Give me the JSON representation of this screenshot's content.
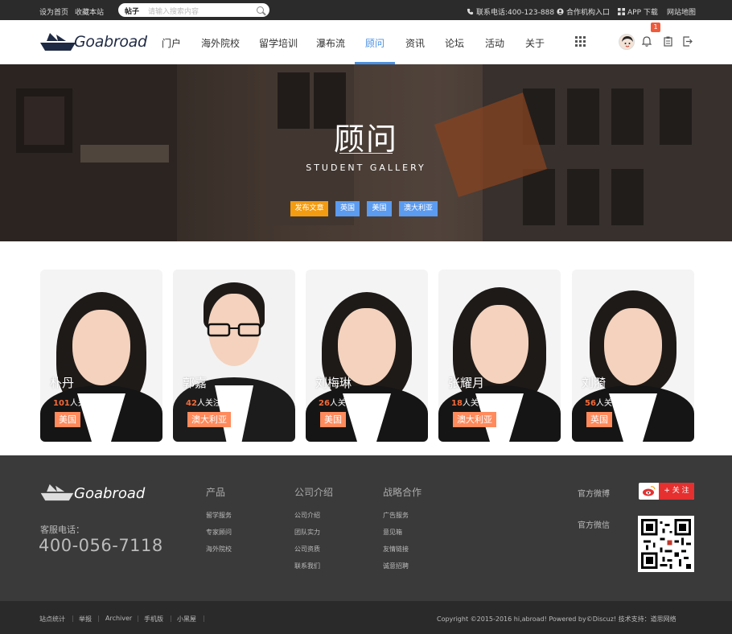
{
  "topbar": {
    "set_home": "设为首页",
    "bookmark": "收藏本站",
    "search_category": "帖子",
    "search_placeholder": "请输入搜索内容",
    "phone": "联系电话:400-123-888",
    "partner": "合作机构入口",
    "app": "APP 下载",
    "sitemap": "网站地图"
  },
  "header": {
    "logo_text": "Goabroad",
    "nav": [
      "门户",
      "海外院校",
      "留学培训",
      "瀑布流",
      "顾问",
      "资讯",
      "论坛",
      "活动",
      "关于"
    ],
    "active_index": 4,
    "notification_count": "1"
  },
  "banner": {
    "title": "顾问",
    "subtitle": "STUDENT GALLERY",
    "buttons": [
      {
        "label": "发布文章",
        "color": "#f39c12"
      },
      {
        "label": "英国",
        "color": "#5b9bf0"
      },
      {
        "label": "美国",
        "color": "#5b9bf0"
      },
      {
        "label": "澳大利亚",
        "color": "#5b9bf0"
      }
    ]
  },
  "consultants": [
    {
      "name": "朴丹",
      "followers": "101",
      "follow_suffix": "人关注",
      "country": "美国"
    },
    {
      "name": "郭嘉",
      "followers": "42",
      "follow_suffix": "人关注",
      "country": "澳大利亚"
    },
    {
      "name": "刘梅琳",
      "followers": "26",
      "follow_suffix": "人关注",
      "country": "美国"
    },
    {
      "name": "张耀月",
      "followers": "18",
      "follow_suffix": "人关注",
      "country": "澳大利亚"
    },
    {
      "name": "刘漪",
      "followers": "56",
      "follow_suffix": "人关注",
      "country": "英国"
    }
  ],
  "footer": {
    "logo_text": "Goabroad",
    "service_label": "客服电话：",
    "service_phone": "400-056-7118",
    "columns": [
      {
        "title": "产品",
        "items": [
          "留学服务",
          "专家顾问",
          "海外院校"
        ]
      },
      {
        "title": "公司介绍",
        "items": [
          "公司介绍",
          "团队实力",
          "公司资质",
          "联系我们"
        ]
      },
      {
        "title": "战略合作",
        "items": [
          "广告服务",
          "意见箱",
          "友情链接",
          "诚意招聘"
        ]
      }
    ],
    "weibo_label": "官方微博",
    "weibo_follow": "+ 关 注",
    "wechat_label": "官方微信"
  },
  "bottombar": {
    "links": [
      "站点统计",
      "举报",
      "Archiver",
      "手机版",
      "小黑屋"
    ],
    "copyright": "Copyright   ©2015-2016  hi,abroad!  Powered by©Discuz!  技术支持：道思网络"
  }
}
